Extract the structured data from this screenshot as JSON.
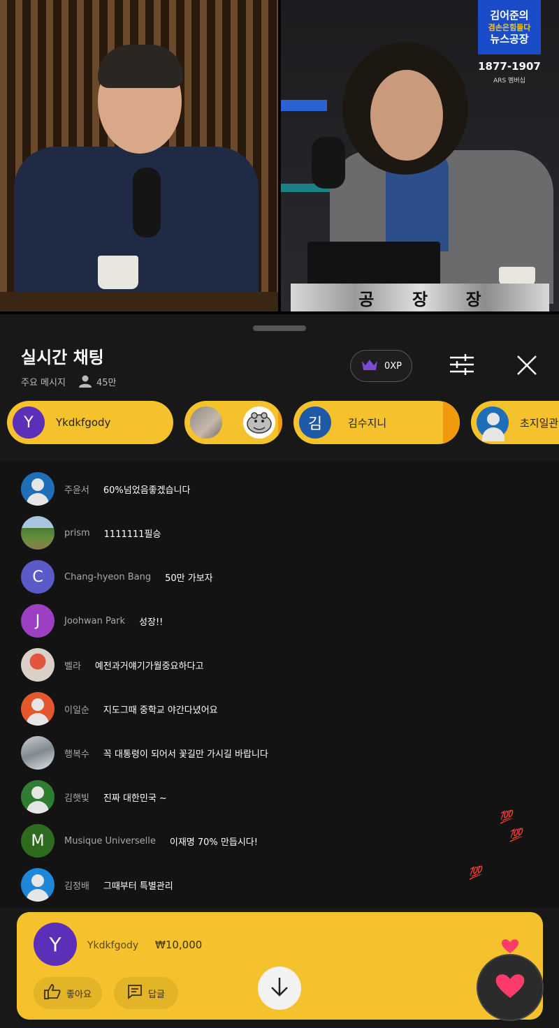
{
  "video": {
    "nameplate_chars": [
      "공",
      "장",
      "장"
    ],
    "logo_lines": [
      "김어준의",
      "겸손은힘들다",
      "뉴스공장"
    ],
    "logo_phone": "1877-1907",
    "logo_ars": "ARS 멤버십"
  },
  "chat": {
    "title": "실시간 채팅",
    "filter_label": "주요 메시지",
    "viewer_count": "45만",
    "xp_label": "0XP",
    "icons": {
      "crown": "crown-icon",
      "filter": "sliders-icon",
      "close": "close-icon",
      "viewers": "person-icon"
    }
  },
  "pinned": [
    {
      "initial": "Y",
      "name": "Ykdkfgody",
      "avatar_color": "#5b2fb8"
    },
    {
      "initial": "",
      "name": "",
      "avatar_color": "#777"
    },
    {
      "initial": "김",
      "name": "김수지니",
      "avatar_color": "#1f5aa8"
    },
    {
      "initial": "",
      "name": "초지일관",
      "avatar_color": "#1e6fb8"
    }
  ],
  "messages": [
    {
      "author": "주윤서",
      "text": "60%넘었음좋겠습니다",
      "avatar": "default",
      "initial": "",
      "color": "#1e6fb8"
    },
    {
      "author": "prism",
      "text": "1111111필승",
      "avatar": "photo-field",
      "initial": "",
      "color": "#5d8f4a"
    },
    {
      "author": "Chang-hyeon Bang",
      "text": "50만 가보자",
      "avatar": "letter",
      "initial": "C",
      "color": "#5a5ac8"
    },
    {
      "author": "Joohwan Park",
      "text": "성장!!",
      "avatar": "letter",
      "initial": "J",
      "color": "#9c3fc2"
    },
    {
      "author": "벨라",
      "text": "예전과거얘기가월중요하다고",
      "avatar": "photo-tulip",
      "initial": "",
      "color": "#d9d0c8"
    },
    {
      "author": "이일순",
      "text": "지도그때 중학교 야간다녔어요",
      "avatar": "default",
      "initial": "",
      "color": "#e5582d"
    },
    {
      "author": "행복수",
      "text": "꼭 대통령이 되어서 꽃길만 가시길 바랍니다",
      "avatar": "photo-snow",
      "initial": "",
      "color": "#8f9aa0"
    },
    {
      "author": "김햇빛",
      "text": "진짜 대한민국 ~",
      "avatar": "default",
      "initial": "",
      "color": "#2e7d32"
    },
    {
      "author": "Musique Universelle",
      "text": "이재명 70% 만듭시다!",
      "avatar": "letter",
      "initial": "M",
      "color": "#2e6b1f"
    },
    {
      "author": "김정배",
      "text": "그때부터 특별관리",
      "avatar": "default",
      "initial": "",
      "color": "#1e88d8"
    }
  ],
  "floating": [
    "💯",
    "💯",
    "💯"
  ],
  "super_chat": {
    "initial": "Y",
    "name": "Ykdkfgody",
    "amount": "₩10,000",
    "like_label": "좋아요",
    "reply_label": "답글"
  },
  "colors": {
    "accent_yellow": "#f5c12c",
    "panel_bg": "#181818",
    "heart": "#ff3b6b"
  }
}
